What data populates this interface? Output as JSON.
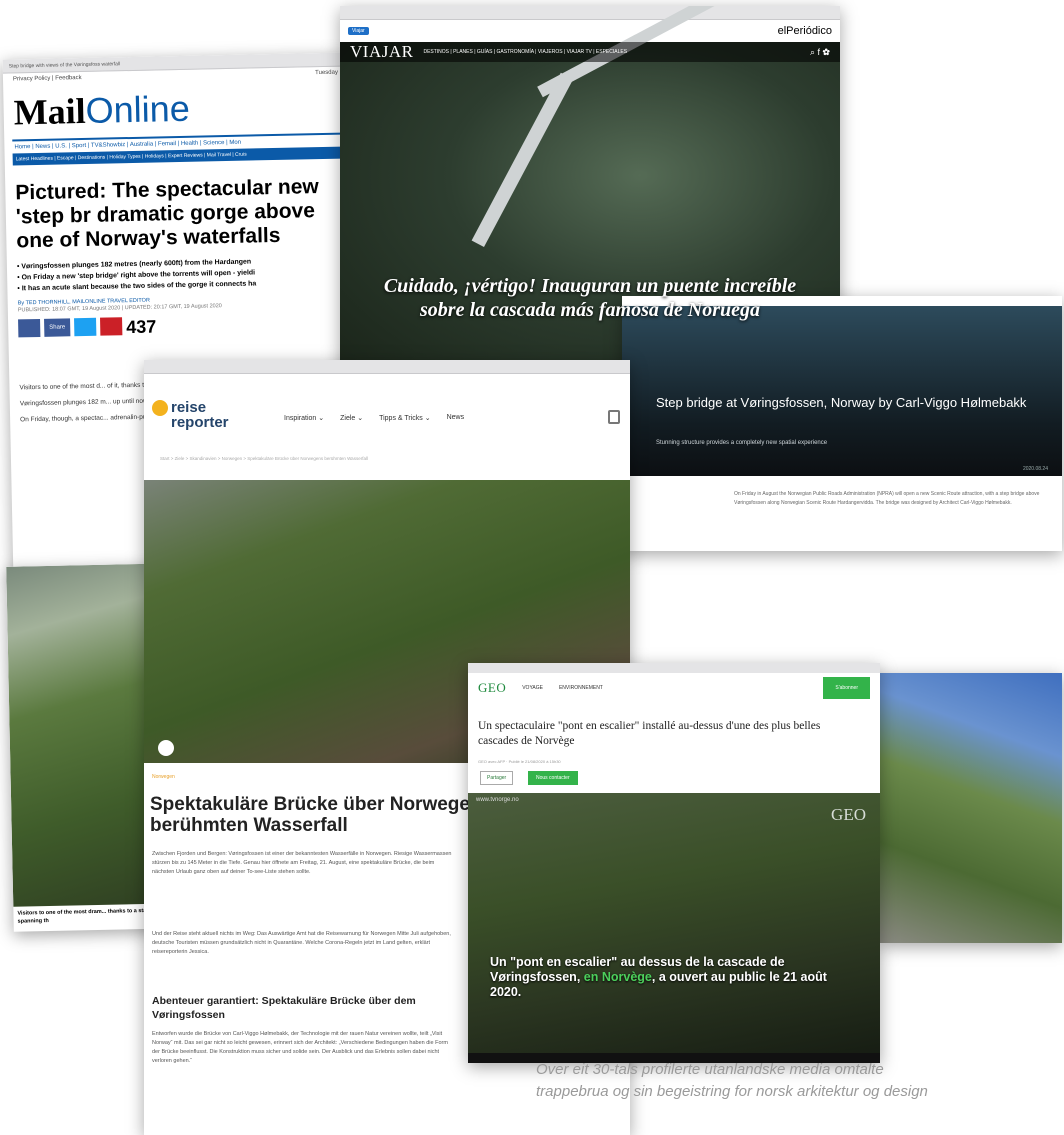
{
  "mail": {
    "tab": "Step bridge with views of the Vøringsfoss waterfall",
    "privacy": "Privacy Policy | Feedback",
    "date_fragment": "Tuesday",
    "logo_bold": "Mail",
    "logo_light": "Online",
    "nav": "Home | News | U.S. | Sport | TV&Showbiz | Australia | Femail | Health | Science | Mon",
    "subnav": "Latest Headlines | Escape | Destinations | Holiday Types | Holidays | Expert Reviews | Mail Travel | Cruis",
    "headline": "Pictured: The spectacular new 'step br dramatic gorge above one of Norway's waterfalls",
    "bullets": [
      "• Vøringsfossen plunges 182 metres (nearly 600ft) from the Hardangen",
      "• On Friday a new 'step bridge' right above the torrents will open - yieldi",
      "• It has an acute slant because the two sides of the gorge it connects ha"
    ],
    "byline": "By TED THORNHILL, MAILONLINE TRAVEL EDITOR",
    "published": "PUBLISHED: 18:07 GMT, 19 August 2020 | UPDATED: 20:17 GMT, 19 August 2020",
    "share_label": "Share",
    "share_count": "437",
    "para1": "Visitors to one of the most d... of it, thanks to a staircase sp...",
    "para2": "Vøringsfossen plunges 182 m... up until now, visitors beheld",
    "para3": "On Friday, though, a spectac... adrenalin-pumping perspect",
    "photo_caption": "Visitors to one of the most dram... thanks to a staircase spanning th"
  },
  "viajar": {
    "tag": "Viajar",
    "elperiodico": "elPeriódico",
    "brand": "VIAJAR",
    "menu": "DESTINOS | PLANES | GUÍAS | GASTRONOMÍA | VIAJEROS | VIAJAR TV | ESPECIALES",
    "headline": "Cuidado, ¡vértigo! Inauguran un puente increíble sobre la cascada más famosa de Noruega"
  },
  "arch": {
    "title": "Step bridge at Vøringsfossen, Norway by Carl-Viggo Hølmebakk",
    "subtitle": "Stunning structure provides a completely new spatial experience",
    "date": "2020.08.24",
    "body": "On Friday in August the Norwegian Public Roads Administration (NPRA) will open a new Scenic Route attraction, with a step bridge above Vøringsfossen along Norwegian Scenic Route Hardangervidda. The bridge was designed by Architect Carl-Viggo Hølmebakk."
  },
  "reise": {
    "logo_line1": "reise",
    "logo_line2": "reporter",
    "menu": [
      "Inspiration ⌄",
      "Ziele ⌄",
      "Tipps & Tricks ⌄",
      "News"
    ],
    "crumb": "Start > Ziele > Skandinavien > Norwegen > Spektakuläre Brücke über Norwegens berühmten Wasserfall",
    "kicker": "Norwegen",
    "headline": "Spektakuläre Brücke über Norwegens berühmten Wasserfall",
    "p1": "Zwischen Fjorden und Bergen: Vøringsfossen ist einer der bekanntesten Wasserfälle in Norwegen. Riesige Wassermassen stürzen bis zu 145 Meter in die Tiefe. Genau hier öffnete am Freitag, 21. August, eine spektakuläre Brücke, die beim nächsten Urlaub ganz oben auf deiner To-see-Liste stehen sollte.",
    "p2": "Und der Reise steht aktuell nichts im Weg: Das Auswärtige Amt hat die Reisewarnung für Norwegen Mitte Juli aufgehoben, deutsche Touristen müssen grundsätzlich nicht in Quarantäne. Welche Corona-Regeln jetzt im Land gelten, erklärt reisereporterin Jessica.",
    "h3": "Abenteuer garantiert: Spektakuläre Brücke über dem Vøringsfossen",
    "p3": "Entworfen wurde die Brücke von Carl-Viggo Hølmebakk, der Technologie mit der rauen Natur vereinen wollte, teilt „Visit Norway“ mit. Das sei gar nicht so leicht gewesen, erinnert sich der Architekt: „Verschiedene Bedingungen haben die Form der Brücke beeinflusst. Die Konstruktion muss sicher und solide sein. Der Ausblick und das Erlebnis sollen dabei nicht verloren gehen.“"
  },
  "geo": {
    "logo": "GEO",
    "nav1": "VOYAGE",
    "nav2": "ENVIRONNEMENT",
    "subscribe": "S'abonner",
    "title": "Un spectaculaire \"pont en escalier\" installé au-dessus d'une des plus belles cascades de Norvège",
    "meta": "GEO avec AFP · Publié le 21/08/2020 à 15h30",
    "pill1": "Partager",
    "pill2": "Nous contacter",
    "video_url": "www.tvnorge.no",
    "video_text_a": "Un \"pont en escalier\" au dessus de la cascade de Vøringsfossen, ",
    "video_text_g": "en Norvège",
    "video_text_b": ", a ouvert au public le 21 août 2020."
  },
  "caption": "Over eit 30-tals profilerte utanlandske media omtalte trappebrua og sin begeistring for norsk arkitektur og design"
}
